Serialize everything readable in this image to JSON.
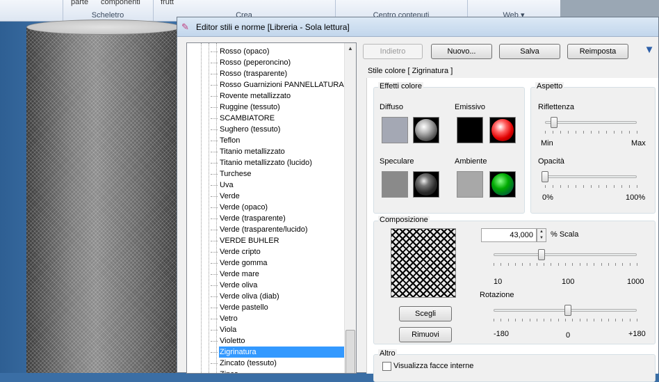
{
  "ribbon": {
    "top_labels": [
      "parte",
      "componenti",
      "frutt"
    ],
    "groups": [
      "Scheletro",
      "Crea",
      "Centro contenuti",
      "Web ▾"
    ]
  },
  "dialog": {
    "title": "Editor stili e norme [Libreria - Sola lettura]",
    "tree": {
      "items": [
        "Rosso (opaco)",
        "Rosso (peperoncino)",
        "Rosso (trasparente)",
        "Rosso Guarnizioni PANNELLATURA",
        "Rovente metallizzato",
        "Ruggine (tessuto)",
        "SCAMBIATORE",
        "Sughero (tessuto)",
        "Teflon",
        "Titanio metallizzato",
        "Titanio metallizzato (lucido)",
        "Turchese",
        "Uva",
        "Verde",
        "Verde (opaco)",
        "Verde (trasparente)",
        "Verde (trasparente/lucido)",
        "VERDE BUHLER",
        "Verde cripto",
        "Verde gomma",
        "Verde mare",
        "Verde oliva",
        "Verde oliva (diab)",
        "Verde pastello",
        "Vetro",
        "Viola",
        "Violetto",
        "Zigrinatura",
        "Zincato (tessuto)",
        "Zinco"
      ],
      "selected": "Zigrinatura"
    },
    "buttons": {
      "back": "Indietro",
      "new": "Nuovo...",
      "save": "Salva",
      "reset": "Reimposta"
    },
    "style_caption": "Stile colore [ Zigrinatura ]",
    "color_effects": {
      "label": "Effetti colore",
      "diffuse": "Diffuso",
      "emissive": "Emissivo",
      "specular": "Speculare",
      "ambient": "Ambiente",
      "colors": {
        "diffuse": "#a4a8b4",
        "emissive": "#000000",
        "specular": "#8a8a8a",
        "ambient": "#a8a8a8"
      }
    },
    "aspect": {
      "label": "Aspetto",
      "reflectance": "Riflettenza",
      "min": "Min",
      "max": "Max",
      "opacity": "Opacità",
      "opacity_min": "0%",
      "opacity_max": "100%",
      "reflectance_level": 0.1,
      "opacity_level": 0.0
    },
    "composition": {
      "label": "Composizione",
      "scale_value": "43,000",
      "scale_label": "% Scala",
      "scale_ticks": [
        "10",
        "100",
        "1000"
      ],
      "rotation_label": "Rotazione",
      "rotation_ticks": [
        "-180",
        "0",
        "+180"
      ],
      "choose": "Scegli",
      "remove": "Rimuovi"
    },
    "other": {
      "label": "Altro",
      "show_inner_faces": "Visualizza facce interne"
    }
  }
}
